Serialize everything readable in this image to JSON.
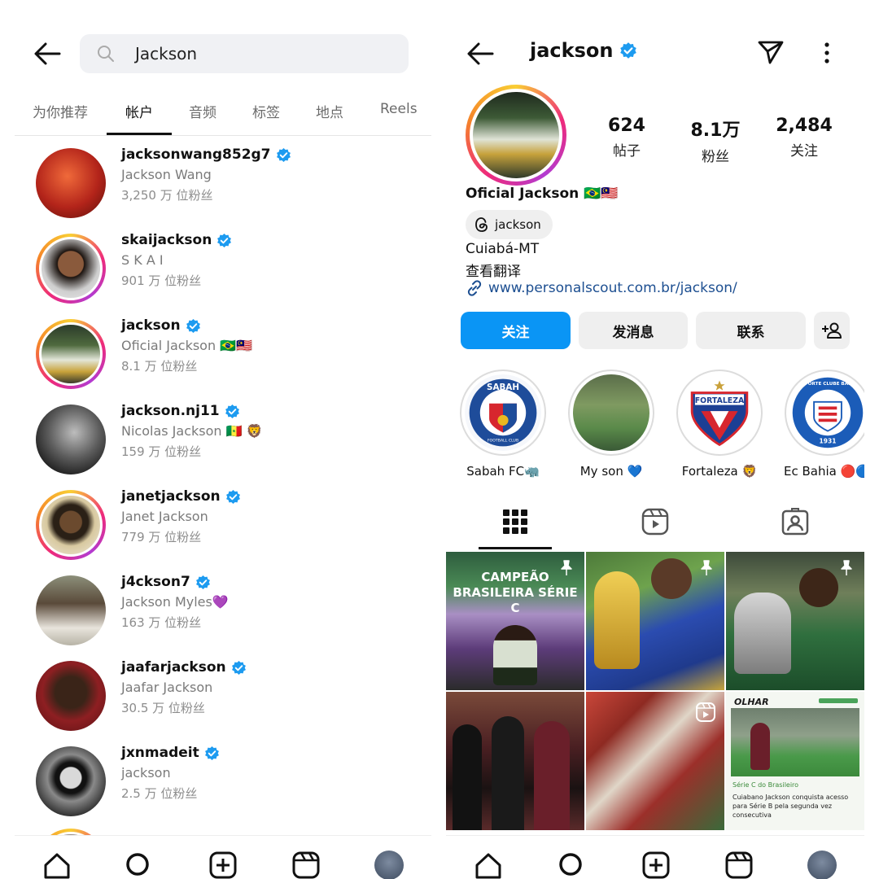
{
  "left": {
    "search": {
      "value": "Jackson"
    },
    "tabs": [
      "为你推荐",
      "帐户",
      "音频",
      "标签",
      "地点",
      "Reels"
    ],
    "active_tab": "帐户",
    "accounts": [
      {
        "username": "jacksonwang852g7",
        "full_name": "Jackson Wang",
        "followers": "3,250 万 位粉丝",
        "verified": true,
        "story_ring": false
      },
      {
        "username": "skaijackson",
        "full_name": "S K A I",
        "followers": "901 万 位粉丝",
        "verified": true,
        "story_ring": true
      },
      {
        "username": "jackson",
        "full_name": "Oficial Jackson 🇧🇷🇲🇾",
        "followers": "8.1 万 位粉丝",
        "verified": true,
        "story_ring": true
      },
      {
        "username": "jackson.nj11",
        "full_name": "Nicolas Jackson 🇸🇳 🦁",
        "followers": "159 万 位粉丝",
        "verified": true,
        "story_ring": false
      },
      {
        "username": "janetjackson",
        "full_name": "Janet Jackson",
        "followers": "779 万 位粉丝",
        "verified": true,
        "story_ring": true
      },
      {
        "username": "j4ckson7",
        "full_name": "Jackson Myles💜",
        "followers": "163 万 位粉丝",
        "verified": true,
        "story_ring": false
      },
      {
        "username": "jaafarjackson",
        "full_name": "Jaafar Jackson",
        "followers": "30.5 万 位粉丝",
        "verified": true,
        "story_ring": false
      },
      {
        "username": "jxnmadeit",
        "full_name": "jackson",
        "followers": "2.5 万 位粉丝",
        "verified": true,
        "story_ring": false
      }
    ]
  },
  "right": {
    "username": "jackson",
    "stats": [
      {
        "value": "624",
        "label": "帖子"
      },
      {
        "value": "8.1万",
        "label": "粉丝"
      },
      {
        "value": "2,484",
        "label": "关注"
      }
    ],
    "display_name": "Oficial Jackson 🇧🇷🇲🇾",
    "threads_handle": "jackson",
    "bio_location": "Cuiabá-MT",
    "translate": "查看翻译",
    "link": "www.personalscout.com.br/jackson/",
    "buttons": {
      "follow": "关注",
      "message": "发消息",
      "contact": "联系"
    },
    "highlights": [
      {
        "label": "Sabah FC🦏",
        "badge_text": "SABAH",
        "badge_sub": "FOOTBALL CLUB"
      },
      {
        "label": "My son 💙"
      },
      {
        "label": "Fortaleza 🦁",
        "badge_text": "FORTALEZA"
      },
      {
        "label": "Ec Bahia 🔴🔵⚪",
        "badge_text": "ESPORTE CLUBE BAHIA",
        "badge_sub": "1931"
      }
    ],
    "posts": [
      {
        "title": "CAMPEÃO BRASILEIRA SÉRIE C",
        "pinned": true
      },
      {
        "pinned": true
      },
      {
        "pinned": true
      },
      {},
      {
        "reel": true
      },
      {
        "brand": "OLHAR",
        "headline": "Série C do Brasileiro",
        "caption": "Cuiabano Jackson conquista acesso para Série B pela segunda vez consecutiva"
      }
    ]
  },
  "colors": {
    "accent": "#0a95f5",
    "verified": "#1d9bf0",
    "link": "#1d4f91"
  },
  "icons": [
    "back-arrow-icon",
    "search-icon",
    "verified-icon",
    "send-icon",
    "more-icon",
    "threads-icon",
    "link-icon",
    "add-person-icon",
    "grid-icon",
    "reels-icon",
    "tagged-icon",
    "home-icon",
    "search-nav-icon",
    "create-icon",
    "reels-nav-icon",
    "profile-icon",
    "pin-icon"
  ]
}
